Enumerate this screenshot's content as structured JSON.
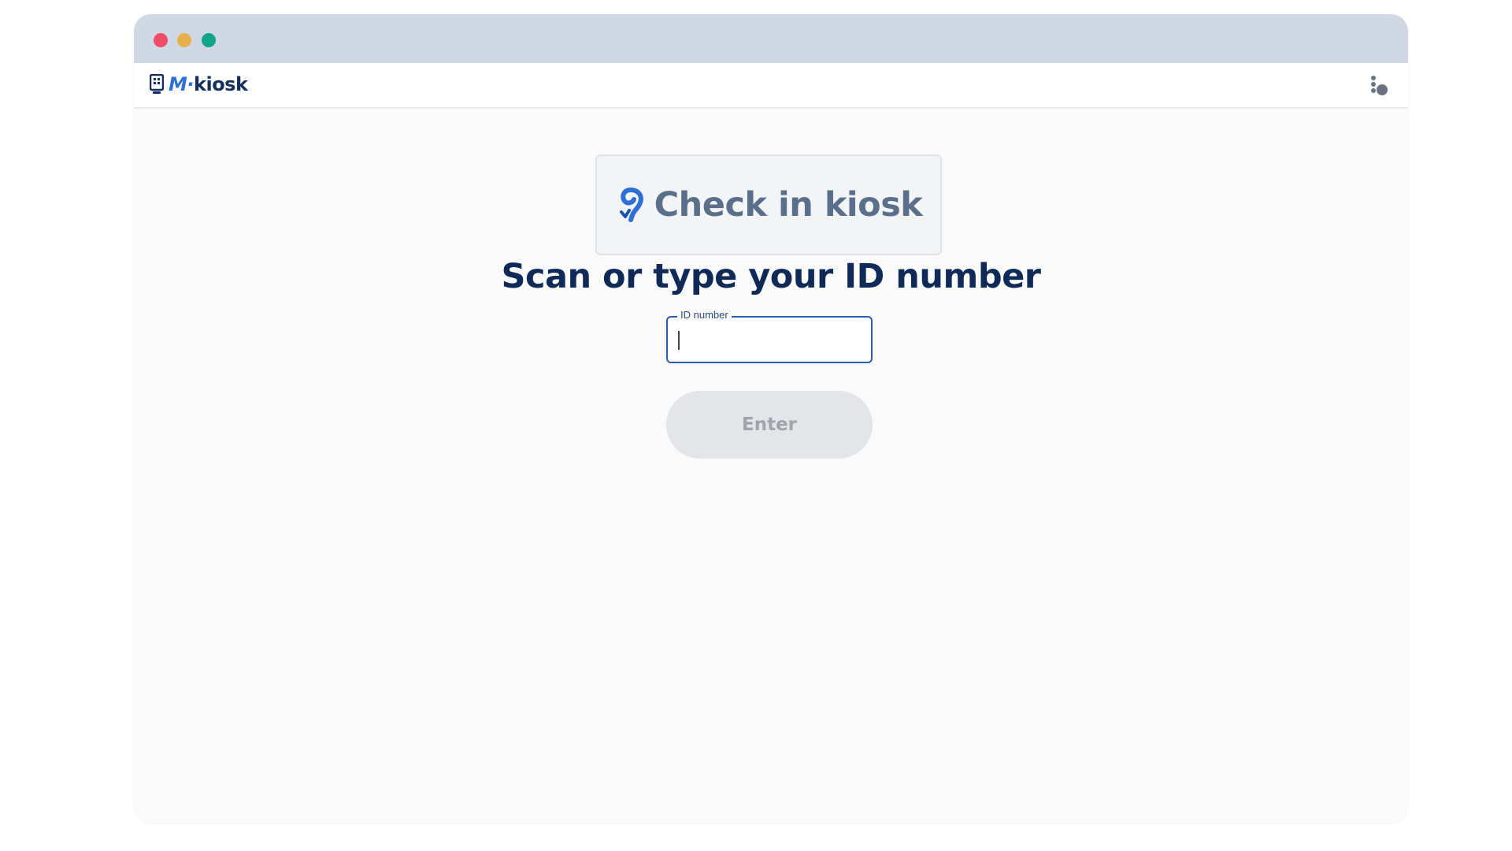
{
  "app": {
    "logo_text": "kiosk",
    "logo_mark": "M·"
  },
  "header": {
    "menu_icon": "user-menu-icon"
  },
  "main": {
    "card_title": "Check in kiosk",
    "card_icon": "checkin-logo-icon",
    "heading": "Scan or type your ID number",
    "id_field": {
      "label": "ID number",
      "value": ""
    },
    "enter_label": "Enter"
  },
  "colors": {
    "titlebar": "#cfd8e3",
    "brand_dark": "#0f2a57",
    "brand_blue": "#2f6fd6",
    "button_disabled": "#e4e5e8"
  }
}
